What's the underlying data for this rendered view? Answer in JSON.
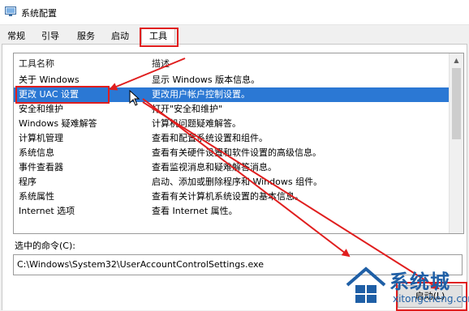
{
  "window": {
    "title": "系统配置"
  },
  "tabs": [
    {
      "label": "常规"
    },
    {
      "label": "引导"
    },
    {
      "label": "服务"
    },
    {
      "label": "启动"
    },
    {
      "label": "工具"
    }
  ],
  "tools_list": {
    "columns": {
      "name": "工具名称",
      "desc": "描述"
    },
    "rows": [
      {
        "name": "关于 Windows",
        "desc": "显示 Windows 版本信息。"
      },
      {
        "name": "更改 UAC 设置",
        "desc": "更改用户帐户控制设置。"
      },
      {
        "name": "安全和维护",
        "desc": "打开\"安全和维护\""
      },
      {
        "name": "Windows 疑难解答",
        "desc": "计算机问题疑难解答。"
      },
      {
        "name": "计算机管理",
        "desc": "查看和配置系统设置和组件。"
      },
      {
        "name": "系统信息",
        "desc": "查看有关硬件设置和软件设置的高级信息。"
      },
      {
        "name": "事件查看器",
        "desc": "查看监视消息和疑难解答消息。"
      },
      {
        "name": "程序",
        "desc": "启动、添加或删除程序和 Windows 组件。"
      },
      {
        "name": "系统属性",
        "desc": "查看有关计算机系统设置的基本信息。"
      },
      {
        "name": "Internet 选项",
        "desc": "查看 Internet 属性。"
      }
    ]
  },
  "command": {
    "label": "选中的命令(C):",
    "value": "C:\\Windows\\System32\\UserAccountControlSettings.exe"
  },
  "launch_button": {
    "label": "启动(L)"
  },
  "watermark": {
    "brand": "系统城",
    "url": "xitongcheng.com"
  },
  "colors": {
    "selection": "#2b78d4",
    "annotation": "#e01e1e",
    "watermark": "#1f5fa6"
  }
}
